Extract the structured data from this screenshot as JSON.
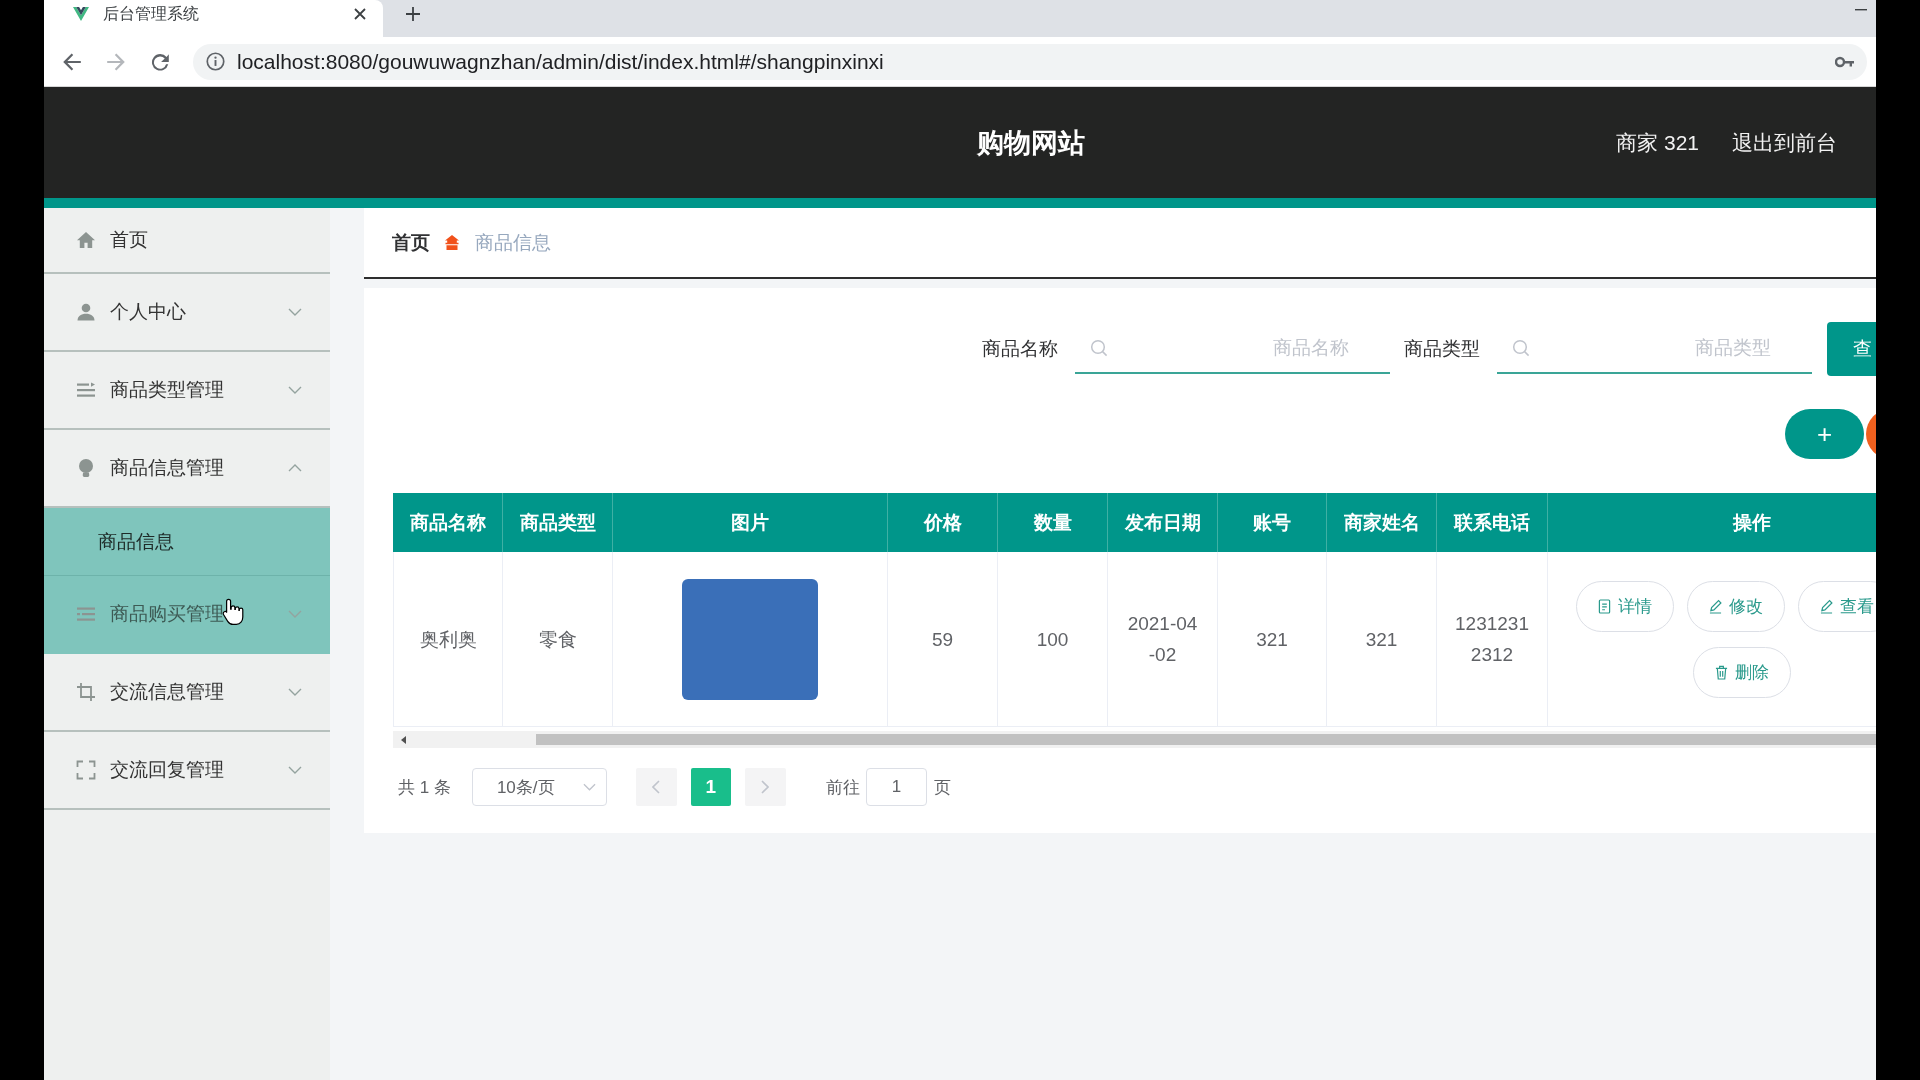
{
  "browser": {
    "tab_title": "后台管理系统",
    "url": "localhost:8080/gouwuwagnzhan/admin/dist/index.html#/shangpinxinxi"
  },
  "header": {
    "title": "购物网站",
    "user": "商家 321",
    "links": [
      "退出到前台"
    ]
  },
  "sidebar": {
    "items": [
      {
        "label": "首页",
        "kind": "link",
        "hovered": false
      },
      {
        "label": "个人中心",
        "kind": "submenu",
        "expanded": false,
        "hovered": false
      },
      {
        "label": "商品类型管理",
        "kind": "submenu",
        "expanded": false,
        "hovered": false
      },
      {
        "label": "商品信息管理",
        "kind": "submenu",
        "expanded": true,
        "hovered": false,
        "children": [
          {
            "label": "商品信息",
            "selected": true
          }
        ]
      },
      {
        "label": "商品购买管理",
        "kind": "submenu",
        "expanded": false,
        "hovered": true
      },
      {
        "label": "交流信息管理",
        "kind": "submenu",
        "expanded": false,
        "hovered": false
      },
      {
        "label": "交流回复管理",
        "kind": "submenu",
        "expanded": false,
        "hovered": false
      }
    ]
  },
  "breadcrumb": [
    {
      "label": "首页",
      "current": false
    },
    {
      "label": "商品信息",
      "current": true
    }
  ],
  "search": {
    "fields": [
      {
        "label": "商品名称",
        "placeholder": "商品名称"
      },
      {
        "label": "商品类型",
        "placeholder": "商品类型"
      }
    ],
    "button": "查"
  },
  "toolbar": {
    "add_button": "+"
  },
  "table": {
    "columns": [
      "商品名称",
      "商品类型",
      "图片",
      "价格",
      "数量",
      "发布日期",
      "账号",
      "商家姓名",
      "联系电话",
      "操作"
    ],
    "rows": [
      {
        "cells": [
          {
            "kind": "text",
            "text": "奥利奥"
          },
          {
            "kind": "text",
            "text": "零食"
          },
          {
            "kind": "image"
          },
          {
            "kind": "text",
            "text": "59"
          },
          {
            "kind": "text",
            "text": "100"
          },
          {
            "kind": "text",
            "text": "2021-04-02"
          },
          {
            "kind": "text",
            "text": "321"
          },
          {
            "kind": "text",
            "text": "321"
          },
          {
            "kind": "text",
            "text": "12312312312"
          },
          {
            "kind": "actions",
            "actions": [
              "详情",
              "修改",
              "查看",
              "删除"
            ]
          }
        ]
      }
    ]
  },
  "pagination": {
    "total": "共 1 条",
    "page_size": "10条/页",
    "prev": {
      "disabled": true
    },
    "pages": [
      {
        "label": "1",
        "selected": true
      }
    ],
    "next": {
      "disabled": true
    },
    "goto_label": "前往",
    "goto_value": "1",
    "goto_suffix": "页"
  }
}
